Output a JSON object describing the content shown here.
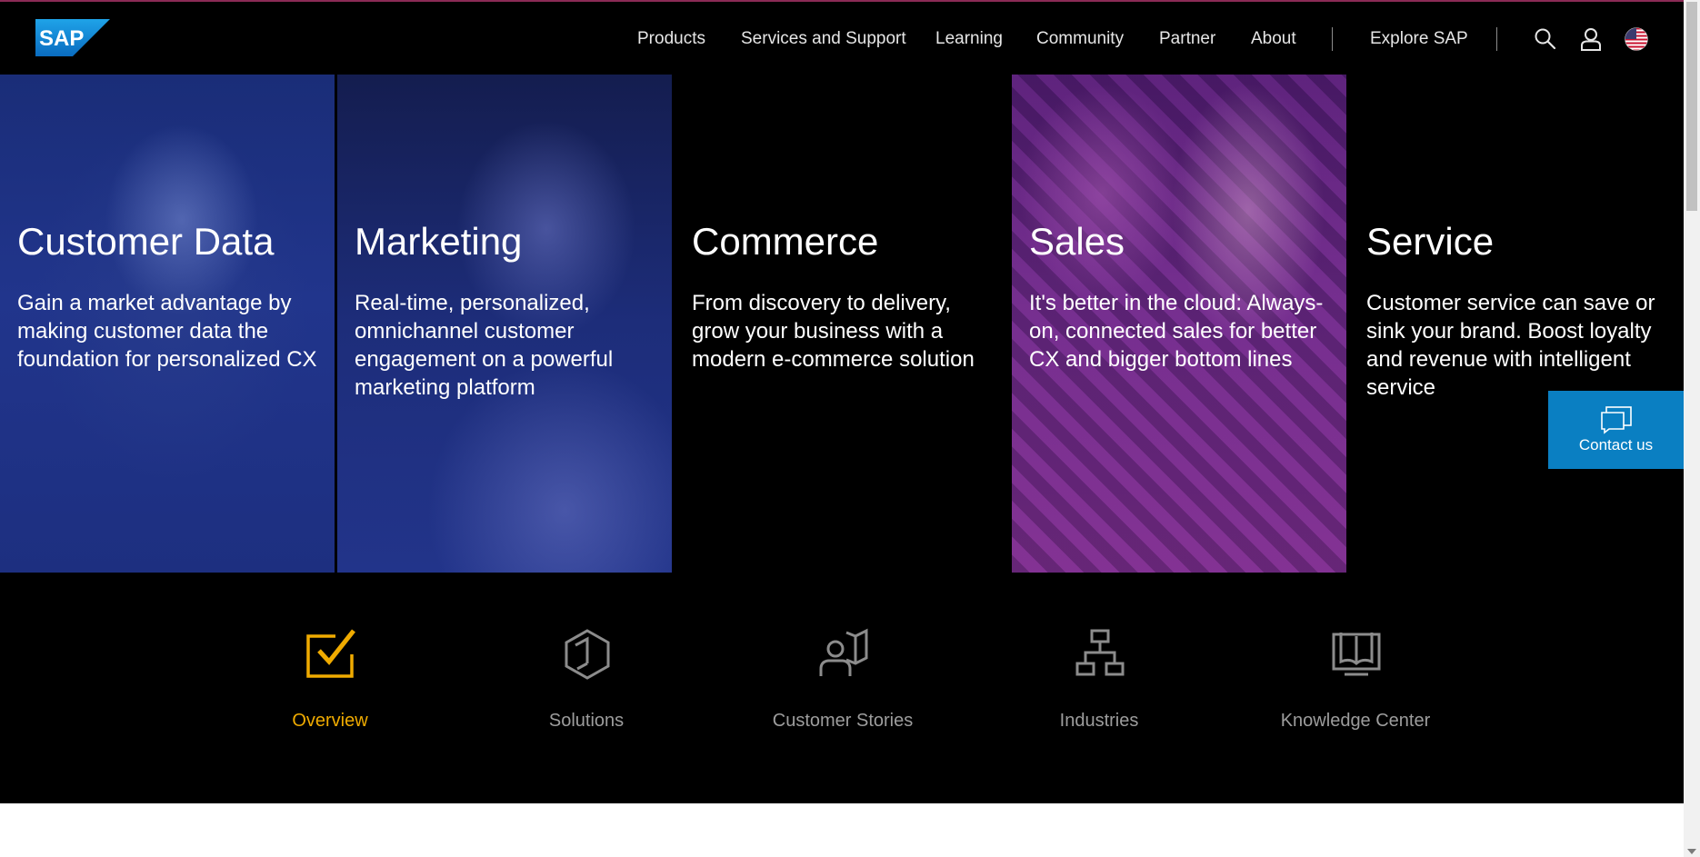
{
  "brand": {
    "logo_text": "SAP",
    "accent": "#f0ab00",
    "logo_blue": "#0a7fc2"
  },
  "nav": {
    "items": [
      {
        "label": "Products"
      },
      {
        "label": "Services and Support"
      },
      {
        "label": "Learning"
      },
      {
        "label": "Community"
      },
      {
        "label": "Partner"
      },
      {
        "label": "About"
      }
    ],
    "explore": "Explore SAP",
    "icons": [
      "search-icon",
      "user-icon",
      "us-flag-icon"
    ]
  },
  "hero": {
    "tiles": [
      {
        "title": "Customer Data",
        "description": "Gain a market advantage by making customer data the foundation for personalized CX"
      },
      {
        "title": "Marketing",
        "description": "Real-time, personalized, omnichannel customer engagement on a powerful marketing platform"
      },
      {
        "title": "Commerce",
        "description": "From discovery to delivery, grow your business with a modern e-commerce solution"
      },
      {
        "title": "Sales",
        "description": "It's better in the cloud: Always-on, connected sales for better CX and bigger bottom lines"
      },
      {
        "title": "Service",
        "description": "Customer service can save or sink your brand. Boost loyalty and revenue with intelligent service"
      }
    ]
  },
  "contact": {
    "label": "Contact us",
    "icon": "chat-icon"
  },
  "subnav": {
    "items": [
      {
        "label": "Overview",
        "icon": "checkbox-icon",
        "active": true
      },
      {
        "label": "Solutions",
        "icon": "cube-icon",
        "active": false
      },
      {
        "label": "Customer Stories",
        "icon": "user-book-icon",
        "active": false
      },
      {
        "label": "Industries",
        "icon": "hierarchy-icon",
        "active": false
      },
      {
        "label": "Knowledge Center",
        "icon": "open-book-icon",
        "active": false
      }
    ]
  }
}
